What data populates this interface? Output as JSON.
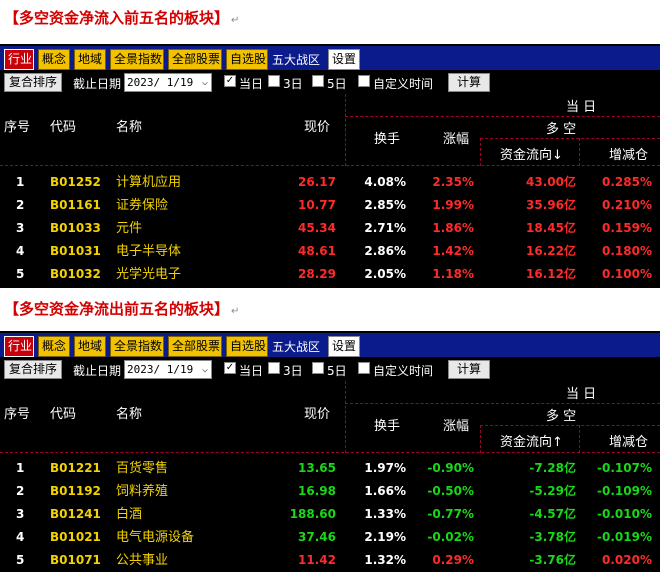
{
  "panels": [
    {
      "heading": "【多空资金净流入前五名的板块】",
      "heading_mark": "↵",
      "nav": {
        "buttons": [
          "行业",
          "概念",
          "地域",
          "全景指数",
          "全部股票",
          "自选股"
        ],
        "active_index": 0,
        "zone_text": "五大战区",
        "settings_label": "设置"
      },
      "toolbar": {
        "sort_label": "复合排序",
        "date_label": "截止日期",
        "date_value": "2023/ 1/19",
        "options": [
          {
            "label": "当日",
            "checked": true
          },
          {
            "label": "3日",
            "checked": false
          },
          {
            "label": "5日",
            "checked": false
          },
          {
            "label": "自定义时间",
            "checked": false
          }
        ],
        "calc_label": "计算"
      },
      "headers": {
        "index": "序号",
        "code": "代码",
        "name": "名称",
        "price": "现价",
        "period": "当 日",
        "group": "多 空",
        "turnover": "换手",
        "change": "涨幅",
        "flow": "资金流向↓",
        "increase": "增减仓"
      },
      "rows": [
        {
          "index": "1",
          "code": "B01252",
          "name": "计算机应用",
          "price": "26.17",
          "turnover": "4.08%",
          "change": "2.35%",
          "flow": "43.00亿",
          "increase": "0.285%",
          "price_color": "red",
          "change_color": "red",
          "flow_color": "red",
          "increase_color": "red"
        },
        {
          "index": "2",
          "code": "B01161",
          "name": "证券保险",
          "price": "10.77",
          "turnover": "2.85%",
          "change": "1.99%",
          "flow": "35.96亿",
          "increase": "0.210%",
          "price_color": "red",
          "change_color": "red",
          "flow_color": "red",
          "increase_color": "red"
        },
        {
          "index": "3",
          "code": "B01033",
          "name": "元件",
          "price": "45.34",
          "turnover": "2.71%",
          "change": "1.86%",
          "flow": "18.45亿",
          "increase": "0.159%",
          "price_color": "red",
          "change_color": "red",
          "flow_color": "red",
          "increase_color": "red"
        },
        {
          "index": "4",
          "code": "B01031",
          "name": "电子半导体",
          "price": "48.61",
          "turnover": "2.86%",
          "change": "1.42%",
          "flow": "16.22亿",
          "increase": "0.180%",
          "price_color": "red",
          "change_color": "red",
          "flow_color": "red",
          "increase_color": "red"
        },
        {
          "index": "5",
          "code": "B01032",
          "name": "光学光电子",
          "price": "28.29",
          "turnover": "2.05%",
          "change": "1.18%",
          "flow": "16.12亿",
          "increase": "0.100%",
          "price_color": "red",
          "change_color": "red",
          "flow_color": "red",
          "increase_color": "red"
        }
      ]
    },
    {
      "heading": "【多空资金净流出前五名的板块】",
      "heading_mark": "↵",
      "nav": {
        "buttons": [
          "行业",
          "概念",
          "地域",
          "全景指数",
          "全部股票",
          "自选股"
        ],
        "active_index": 0,
        "zone_text": "五大战区",
        "settings_label": "设置"
      },
      "toolbar": {
        "sort_label": "复合排序",
        "date_label": "截止日期",
        "date_value": "2023/ 1/19",
        "options": [
          {
            "label": "当日",
            "checked": true
          },
          {
            "label": "3日",
            "checked": false
          },
          {
            "label": "5日",
            "checked": false
          },
          {
            "label": "自定义时间",
            "checked": false
          }
        ],
        "calc_label": "计算"
      },
      "headers": {
        "index": "序号",
        "code": "代码",
        "name": "名称",
        "price": "现价",
        "period": "当 日",
        "group": "多 空",
        "turnover": "换手",
        "change": "涨幅",
        "flow": "资金流向↑",
        "increase": "增减仓"
      },
      "rows": [
        {
          "index": "1",
          "code": "B01221",
          "name": "百货零售",
          "price": "13.65",
          "turnover": "1.97%",
          "change": "-0.90%",
          "flow": "-7.28亿",
          "increase": "-0.107%",
          "price_color": "green",
          "change_color": "green",
          "flow_color": "green",
          "increase_color": "green"
        },
        {
          "index": "2",
          "code": "B01192",
          "name": "饲料养殖",
          "price": "16.98",
          "turnover": "1.66%",
          "change": "-0.50%",
          "flow": "-5.29亿",
          "increase": "-0.109%",
          "price_color": "green",
          "change_color": "green",
          "flow_color": "green",
          "increase_color": "green"
        },
        {
          "index": "3",
          "code": "B01241",
          "name": "白酒",
          "price": "188.60",
          "turnover": "1.33%",
          "change": "-0.77%",
          "flow": "-4.57亿",
          "increase": "-0.010%",
          "price_color": "green",
          "change_color": "green",
          "flow_color": "green",
          "increase_color": "green"
        },
        {
          "index": "4",
          "code": "B01021",
          "name": "电气电源设备",
          "price": "37.46",
          "turnover": "2.19%",
          "change": "-0.02%",
          "flow": "-3.78亿",
          "increase": "-0.019%",
          "price_color": "green",
          "change_color": "green",
          "flow_color": "green",
          "increase_color": "green"
        },
        {
          "index": "5",
          "code": "B01071",
          "name": "公共事业",
          "price": "11.42",
          "turnover": "1.32%",
          "change": "0.29%",
          "flow": "-3.76亿",
          "increase": "0.020%",
          "price_color": "red",
          "change_color": "red",
          "flow_color": "green",
          "increase_color": "red"
        }
      ]
    }
  ]
}
